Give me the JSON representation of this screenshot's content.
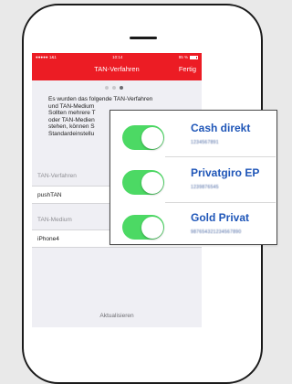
{
  "status_bar": {
    "carrier": "●●●●● 1&1",
    "time": "10:14",
    "battery": "95 %"
  },
  "nav": {
    "title": "TAN-Verfahren",
    "action": "Fertig"
  },
  "message_lines": [
    "Es wurden das folgende TAN-Verfahren",
    "und TAN-Medium",
    "Sollten mehrere T",
    "oder TAN-Medien",
    "stehen, können S",
    "Standardeinstellu"
  ],
  "tan_procedure": {
    "label": "TAN-Verfahren",
    "value": "pushTAN"
  },
  "tan_medium": {
    "label": "TAN-Medium",
    "value": "iPhone4"
  },
  "refresh_label": "Aktualisieren",
  "accounts": [
    {
      "name": "Cash direkt",
      "number": "1234567891",
      "enabled": true
    },
    {
      "name": "Privatgiro EP",
      "number": "1239876545",
      "enabled": true
    },
    {
      "name": "Gold Privat",
      "number": "987654321234567890",
      "enabled": true
    }
  ],
  "colors": {
    "nav_red": "#ec1c24",
    "toggle_green": "#4cd964",
    "account_blue": "#1f56b8"
  }
}
